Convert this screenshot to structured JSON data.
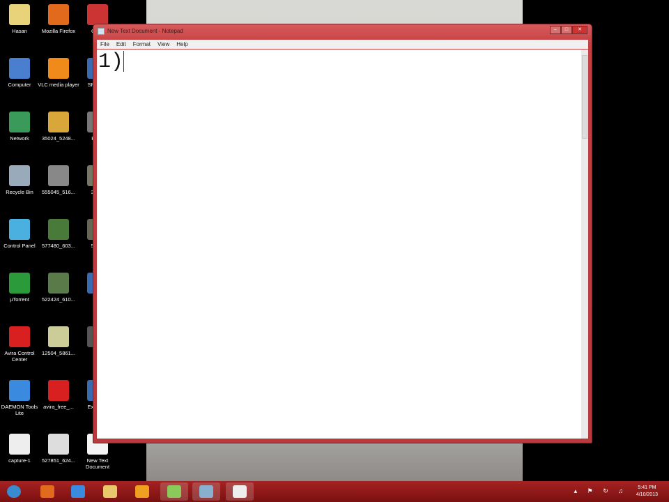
{
  "desktop": {
    "icons": [
      {
        "label": "Hasan",
        "color": "#e8d27a"
      },
      {
        "label": "Mozilla Firefox",
        "color": "#e26a1c"
      },
      {
        "label": "Chr...",
        "color": "#c33"
      },
      {
        "label": "Computer",
        "color": "#4a7fd0"
      },
      {
        "label": "VLC media player",
        "color": "#f08a1a"
      },
      {
        "label": "SP... S...",
        "color": "#3a6ab0"
      },
      {
        "label": "Network",
        "color": "#3a9a5a"
      },
      {
        "label": "35024_5248...",
        "color": "#d9a63a"
      },
      {
        "label": "Bef...",
        "color": "#777"
      },
      {
        "label": "Recycle Bin",
        "color": "#9ab"
      },
      {
        "label": "555045_516...",
        "color": "#888"
      },
      {
        "label": "394...",
        "color": "#776"
      },
      {
        "label": "Control Panel",
        "color": "#4ab0e0"
      },
      {
        "label": "577480_603...",
        "color": "#4a7a3a"
      },
      {
        "label": "579...",
        "color": "#665"
      },
      {
        "label": "µTorrent",
        "color": "#2a9a3a"
      },
      {
        "label": "522424_610...",
        "color": "#5a7a4a"
      },
      {
        "label": "C...",
        "color": "#3a6ab0"
      },
      {
        "label": "Avira Control Center",
        "color": "#d92020"
      },
      {
        "label": "12504_5861...",
        "color": "#cc9"
      },
      {
        "label": "...",
        "color": "#555"
      },
      {
        "label": "DAEMON Tools Lite",
        "color": "#3a8ae0"
      },
      {
        "label": "avira_free_...",
        "color": "#d92020"
      },
      {
        "label": "Ex... C...",
        "color": "#3a6ab0"
      },
      {
        "label": "capture-1",
        "color": "#eee"
      },
      {
        "label": "527851_624...",
        "color": "#ddd"
      },
      {
        "label": "New Text Document",
        "color": "#f4f4f4"
      }
    ]
  },
  "notepad": {
    "title": "New Text Document - Notepad",
    "menu": [
      "File",
      "Edit",
      "Format",
      "View",
      "Help"
    ],
    "content": "1)"
  },
  "taskbar": {
    "apps": [
      {
        "name": "start",
        "color": "#3a8ad0"
      },
      {
        "name": "firefox",
        "color": "#e26a1c"
      },
      {
        "name": "internet-explorer",
        "color": "#3a8ae0"
      },
      {
        "name": "explorer",
        "color": "#e8c86a"
      },
      {
        "name": "media-player",
        "color": "#f0a020"
      },
      {
        "name": "app",
        "color": "#8aca5a"
      },
      {
        "name": "app2",
        "color": "#8ab0d0"
      },
      {
        "name": "notepad",
        "color": "#eee"
      }
    ],
    "tray": "▴ ⚑ ↻ ♫",
    "time": "5:41 PM",
    "date": "4/10/2013"
  }
}
